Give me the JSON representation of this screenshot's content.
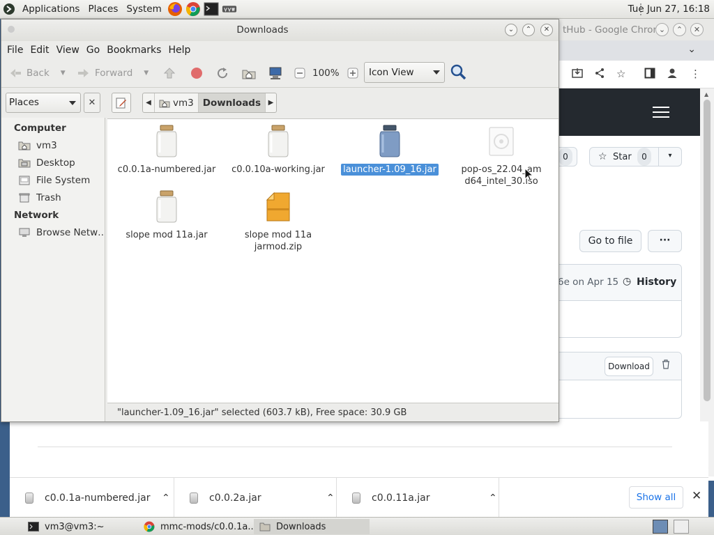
{
  "top_panel": {
    "menus": [
      "Applications",
      "Places",
      "System"
    ],
    "launchers": [
      "firefox-icon",
      "chrome-icon",
      "terminal-icon",
      "vm-icon"
    ],
    "clock": "Tue Jun 27, 16:18"
  },
  "chrome": {
    "title": "tHub - Google Chrome",
    "star_label": "Star",
    "star_count": "0",
    "watch_count": "0",
    "go_to_file": "Go to file",
    "more": "···",
    "commit_text": "6e on Apr 15",
    "history_label": "History",
    "download_label": "Download"
  },
  "downloads_bar": {
    "items": [
      "c0.0.1a-numbered.jar",
      "c0.0.2a.jar",
      "c0.0.11a.jar"
    ],
    "show_all": "Show all",
    "close": "✕"
  },
  "taskbar": {
    "items": [
      "vm3@vm3:~",
      "mmc-mods/c0.0.1a...",
      "Downloads"
    ]
  },
  "file_manager": {
    "title": "Downloads",
    "menus": [
      "File",
      "Edit",
      "View",
      "Go",
      "Bookmarks",
      "Help"
    ],
    "toolbar": {
      "back": "Back",
      "forward": "Forward",
      "zoom": "100%",
      "view_mode": "Icon View"
    },
    "location": {
      "places_select": "Places",
      "crumbs": [
        "vm3",
        "Downloads"
      ]
    },
    "sidebar": {
      "computer_heading": "Computer",
      "computer_items": [
        "vm3",
        "Desktop",
        "File System",
        "Trash"
      ],
      "network_heading": "Network",
      "network_items": [
        "Browse Netw…"
      ]
    },
    "files": [
      {
        "name": "c0.0.1a-numbered.jar",
        "type": "jar"
      },
      {
        "name": "c0.0.10a-working.jar",
        "type": "jar"
      },
      {
        "name": "launcher-1.09_16.jar",
        "type": "jar",
        "selected": true
      },
      {
        "name": "pop-os_22.04_amd64_intel_30.iso",
        "type": "iso"
      },
      {
        "name": "slope mod 11a.jar",
        "type": "jar"
      },
      {
        "name": "slope mod 11a jarmod.zip",
        "type": "zip"
      }
    ],
    "status": "\"launcher-1.09_16.jar\" selected (603.7 kB), Free space: 30.9 GB"
  }
}
